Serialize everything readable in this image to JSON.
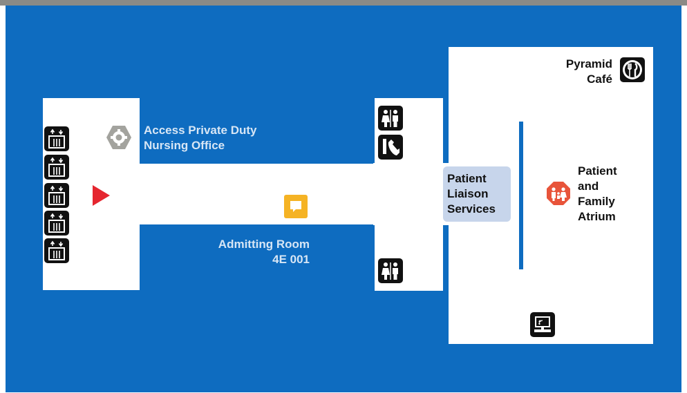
{
  "labels": {
    "nursing_office": [
      "Access Private Duty",
      "Nursing Office"
    ],
    "admitting_room": [
      "Admitting Room",
      "4E 001"
    ],
    "patient_liaison": [
      "Patient",
      "Liaison",
      "Services"
    ],
    "pyramid_cafe": [
      "Pyramid",
      "Café"
    ],
    "atrium": [
      "Patient",
      "and",
      "Family",
      "Atrium"
    ]
  },
  "icons": {
    "elevators": [
      "elevator-icon",
      "elevator-icon",
      "elevator-icon",
      "elevator-icon",
      "elevator-icon"
    ],
    "you_are_here": "you-are-here-marker",
    "service_point": "gear-icon",
    "information": "chat-bubble-icon",
    "restrooms": [
      "restroom-icon",
      "restroom-icon"
    ],
    "phone": "phone-icon",
    "cafe": "fork-knife-icon",
    "family": "family-icon",
    "kiosk": "computer-kiosk-icon"
  },
  "colors": {
    "background_blue": "#0e6cc0",
    "top_band_gray": "#8a8a86",
    "marker_red": "#e5262f",
    "info_yellow": "#f5b324",
    "family_orange": "#e8543a",
    "gear_gray": "#a3a39e",
    "liaison_highlight": "#c7d5eb"
  }
}
